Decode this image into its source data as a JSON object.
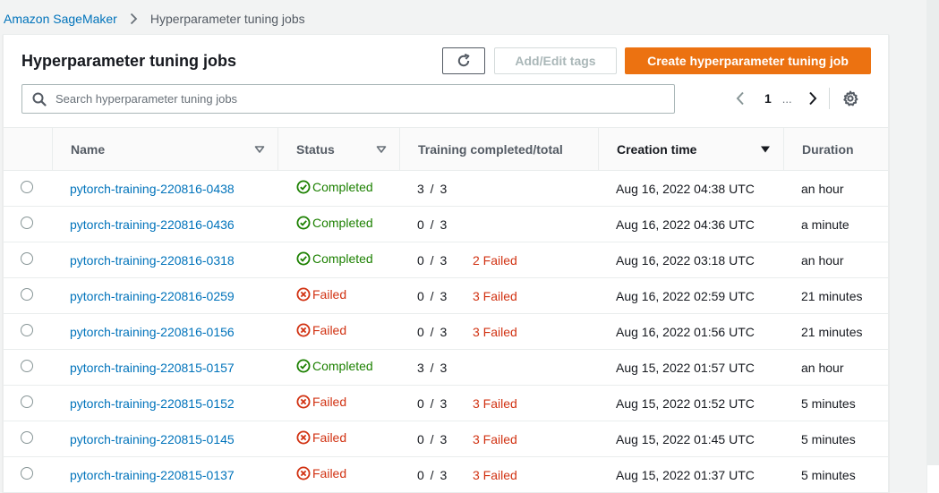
{
  "breadcrumb": {
    "root": "Amazon SageMaker",
    "current": "Hyperparameter tuning jobs"
  },
  "panel": {
    "title": "Hyperparameter tuning jobs"
  },
  "toolbar": {
    "tags_label": "Add/Edit tags",
    "create_label": "Create hyperparameter tuning job"
  },
  "search": {
    "placeholder": "Search hyperparameter tuning jobs",
    "value": ""
  },
  "pagination": {
    "current_page": "1",
    "ellipsis": "..."
  },
  "table": {
    "columns": {
      "name": "Name",
      "status": "Status",
      "training": "Training completed/total",
      "creation_time": "Creation time",
      "duration": "Duration"
    },
    "sorted_column": "creation_time",
    "rows": [
      {
        "name": "pytorch-training-220816-0438",
        "status": "Completed",
        "training": "3 / 3",
        "failed": "",
        "creation_time": "Aug 16, 2022 04:38 UTC",
        "duration": "an hour"
      },
      {
        "name": "pytorch-training-220816-0436",
        "status": "Completed",
        "training": "0 / 3",
        "failed": "",
        "creation_time": "Aug 16, 2022 04:36 UTC",
        "duration": "a minute"
      },
      {
        "name": "pytorch-training-220816-0318",
        "status": "Completed",
        "training": "0 / 3",
        "failed": "2 Failed",
        "creation_time": "Aug 16, 2022 03:18 UTC",
        "duration": "an hour"
      },
      {
        "name": "pytorch-training-220816-0259",
        "status": "Failed",
        "training": "0 / 3",
        "failed": "3 Failed",
        "creation_time": "Aug 16, 2022 02:59 UTC",
        "duration": "21 minutes"
      },
      {
        "name": "pytorch-training-220816-0156",
        "status": "Failed",
        "training": "0 / 3",
        "failed": "3 Failed",
        "creation_time": "Aug 16, 2022 01:56 UTC",
        "duration": "21 minutes"
      },
      {
        "name": "pytorch-training-220815-0157",
        "status": "Completed",
        "training": "3 / 3",
        "failed": "",
        "creation_time": "Aug 15, 2022 01:57 UTC",
        "duration": "an hour"
      },
      {
        "name": "pytorch-training-220815-0152",
        "status": "Failed",
        "training": "0 / 3",
        "failed": "3 Failed",
        "creation_time": "Aug 15, 2022 01:52 UTC",
        "duration": "5 minutes"
      },
      {
        "name": "pytorch-training-220815-0145",
        "status": "Failed",
        "training": "0 / 3",
        "failed": "3 Failed",
        "creation_time": "Aug 15, 2022 01:45 UTC",
        "duration": "5 minutes"
      },
      {
        "name": "pytorch-training-220815-0137",
        "status": "Failed",
        "training": "0 / 3",
        "failed": "3 Failed",
        "creation_time": "Aug 15, 2022 01:37 UTC",
        "duration": "5 minutes"
      }
    ]
  },
  "colors": {
    "link": "#0073bb",
    "primary": "#ec7211",
    "success": "#1d8102",
    "error": "#d13212",
    "header_bg": "#fafafa",
    "page_bg": "#f2f3f3"
  },
  "icons": {
    "refresh": "refresh-icon",
    "search": "search-icon",
    "settings": "gear-icon",
    "completed": "check-circle-icon",
    "failed": "x-circle-icon",
    "sort_inactive": "caret-down-outline-icon",
    "sort_active": "caret-down-filled-icon"
  }
}
